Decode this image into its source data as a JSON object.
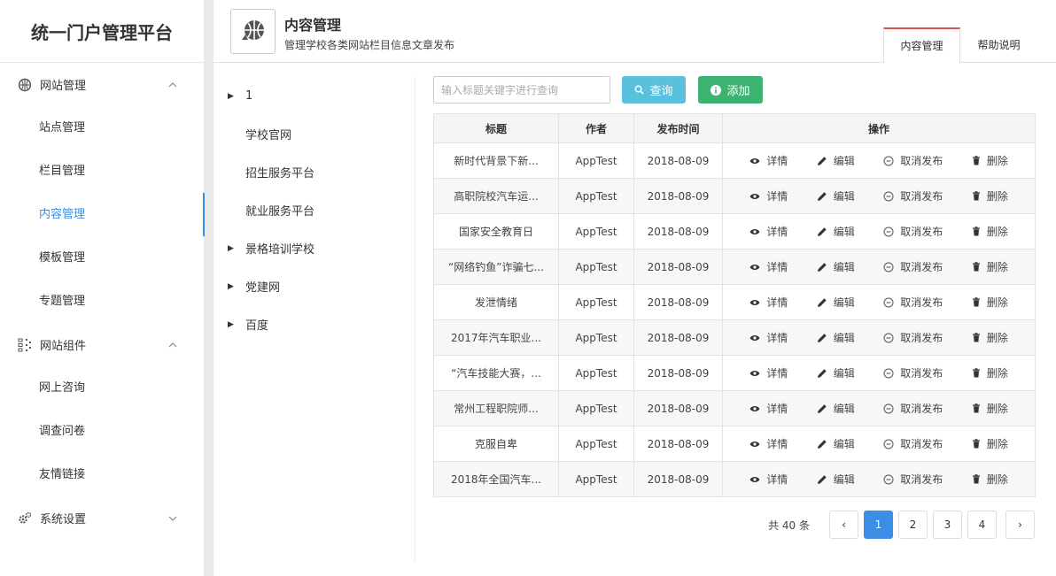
{
  "app": {
    "title": "统一门户管理平台"
  },
  "sidebar": {
    "groups": [
      {
        "label": "网站管理",
        "icon": "globe-icon",
        "items": [
          "站点管理",
          "栏目管理",
          "内容管理",
          "模板管理",
          "专题管理"
        ]
      },
      {
        "label": "网站组件",
        "icon": "component-icon",
        "items": [
          "网上咨询",
          "调查问卷",
          "友情链接"
        ]
      },
      {
        "label": "系统设置",
        "icon": "gears-icon",
        "items": []
      }
    ],
    "active_item": "内容管理"
  },
  "header": {
    "title": "内容管理",
    "subtitle": "管理学校各类网站栏目信息文章发布",
    "tabs": [
      "内容管理",
      "帮助说明"
    ]
  },
  "tree": [
    {
      "label": "1",
      "expandable": true,
      "child": false
    },
    {
      "label": "学校官网",
      "expandable": false,
      "child": true
    },
    {
      "label": "招生服务平台",
      "expandable": false,
      "child": true
    },
    {
      "label": "就业服务平台",
      "expandable": false,
      "child": true
    },
    {
      "label": "景格培训学校",
      "expandable": true,
      "child": false
    },
    {
      "label": "党建网",
      "expandable": true,
      "child": false
    },
    {
      "label": "百度",
      "expandable": true,
      "child": false
    }
  ],
  "toolbar": {
    "search_placeholder": "输入标题关键字进行查询",
    "query_label": "查询",
    "add_label": "添加"
  },
  "table": {
    "headers": [
      "标题",
      "作者",
      "发布时间",
      "操作"
    ],
    "actions": [
      "详情",
      "编辑",
      "取消发布",
      "删除"
    ],
    "rows": [
      {
        "title": "新时代背景下新...",
        "author": "AppTest",
        "date": "2018-08-09"
      },
      {
        "title": "高职院校汽车运...",
        "author": "AppTest",
        "date": "2018-08-09"
      },
      {
        "title": "国家安全教育日",
        "author": "AppTest",
        "date": "2018-08-09"
      },
      {
        "title": "“网络钓鱼”诈骗七...",
        "author": "AppTest",
        "date": "2018-08-09"
      },
      {
        "title": "发泄情绪",
        "author": "AppTest",
        "date": "2018-08-09"
      },
      {
        "title": "2017年汽车职业...",
        "author": "AppTest",
        "date": "2018-08-09"
      },
      {
        "title": "“汽车技能大赛，...",
        "author": "AppTest",
        "date": "2018-08-09"
      },
      {
        "title": "常州工程职院师...",
        "author": "AppTest",
        "date": "2018-08-09"
      },
      {
        "title": "克服自卑",
        "author": "AppTest",
        "date": "2018-08-09"
      },
      {
        "title": "2018年全国汽车...",
        "author": "AppTest",
        "date": "2018-08-09"
      }
    ]
  },
  "pager": {
    "total_text": "共 40 条",
    "pages": [
      "1",
      "2",
      "3",
      "4"
    ],
    "current": "1",
    "prev": "‹",
    "next": "›"
  },
  "colors": {
    "accent": "#3a8ee6",
    "query": "#5bc0de",
    "add": "#3cb371",
    "tab_top": "#d9534f"
  }
}
